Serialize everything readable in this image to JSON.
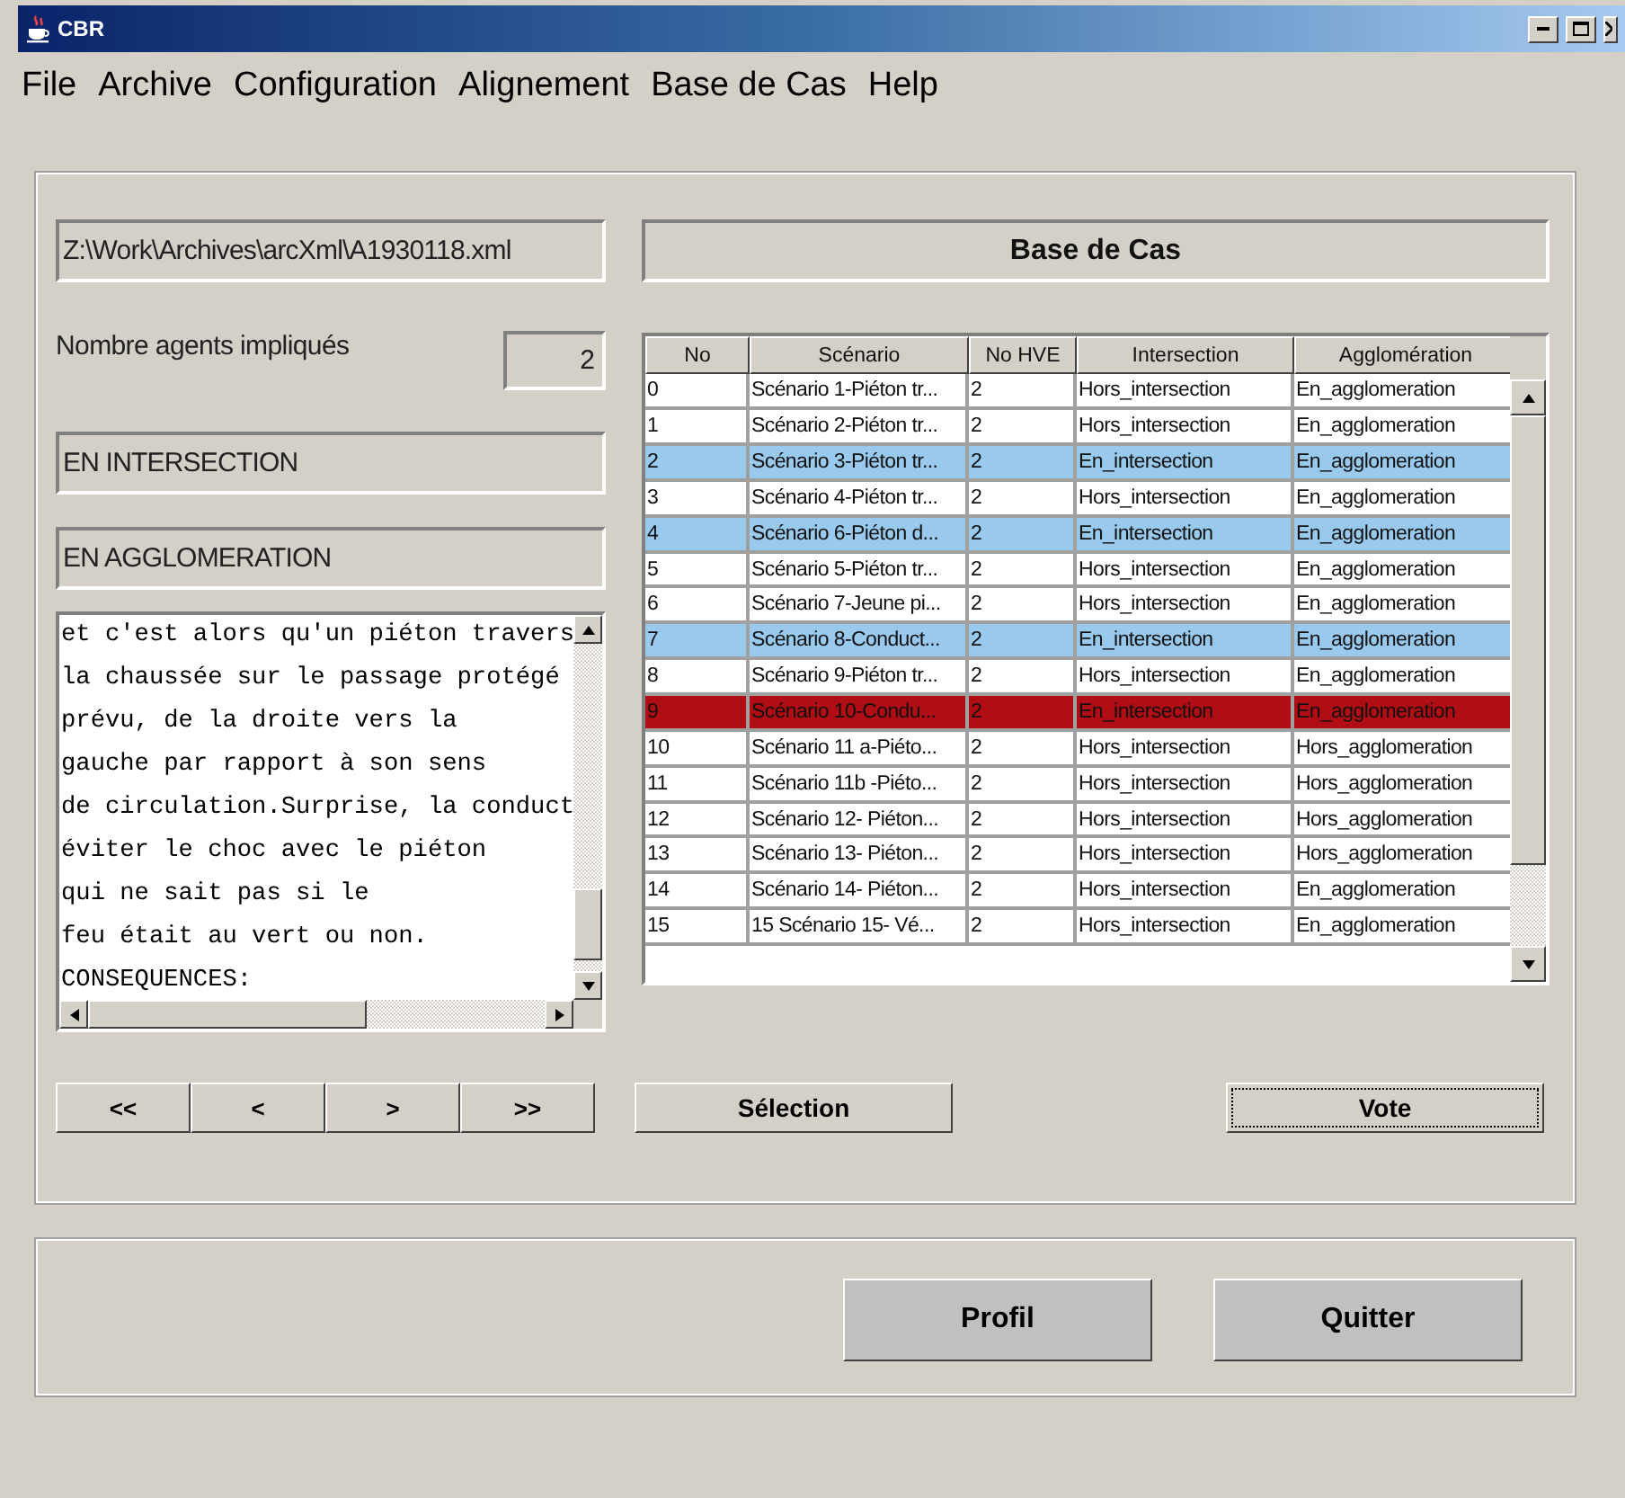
{
  "window": {
    "title": "CBR"
  },
  "menu": [
    "File",
    "Archive",
    "Configuration",
    "Alignement",
    "Base de Cas",
    "Help"
  ],
  "file_path": "Z:\\Work\\Archives\\arcXml\\A1930118.xml",
  "agents": {
    "label": "Nombre agents impliqués",
    "value": "2"
  },
  "intersection_field": "EN INTERSECTION",
  "agglomeration_field": "EN AGGLOMERATION",
  "description_lines": [
    "et c'est alors qu'un piéton travers",
    "la chaussée sur le passage protégé",
    "prévu, de la droite vers la",
    "gauche par rapport à son sens",
    "de circulation.Surprise, la conduct",
    "éviter le choc avec le piéton",
    "qui ne sait pas si le",
    "feu était au vert ou non.",
    "CONSEQUENCES:"
  ],
  "case_base": {
    "title": "Base de Cas",
    "columns": [
      "No",
      "Scénario",
      "No HVE",
      "Intersection",
      "Agglomération"
    ],
    "rows": [
      {
        "cells": [
          "0",
          "Scénario 1-Piéton tr...",
          "2",
          "Hors_intersection",
          "En_agglomeration"
        ],
        "matched": false,
        "selected": false
      },
      {
        "cells": [
          "1",
          "Scénario 2-Piéton tr...",
          "2",
          "Hors_intersection",
          "En_agglomeration"
        ],
        "matched": false,
        "selected": false
      },
      {
        "cells": [
          "2",
          "Scénario 3-Piéton tr...",
          "2",
          "En_intersection",
          "En_agglomeration"
        ],
        "matched": true,
        "selected": false
      },
      {
        "cells": [
          "3",
          "Scénario 4-Piéton tr...",
          "2",
          "Hors_intersection",
          "En_agglomeration"
        ],
        "matched": false,
        "selected": false
      },
      {
        "cells": [
          "4",
          "Scénario 6-Piéton d...",
          "2",
          "En_intersection",
          "En_agglomeration"
        ],
        "matched": true,
        "selected": false
      },
      {
        "cells": [
          "5",
          "Scénario 5-Piéton tr...",
          "2",
          "Hors_intersection",
          "En_agglomeration"
        ],
        "matched": false,
        "selected": false
      },
      {
        "cells": [
          "6",
          "Scénario 7-Jeune pi...",
          "2",
          "Hors_intersection",
          "En_agglomeration"
        ],
        "matched": false,
        "selected": false
      },
      {
        "cells": [
          "7",
          "Scénario 8-Conduct...",
          "2",
          "En_intersection",
          "En_agglomeration"
        ],
        "matched": true,
        "selected": false
      },
      {
        "cells": [
          "8",
          "Scénario 9-Piéton tr...",
          "2",
          "Hors_intersection",
          "En_agglomeration"
        ],
        "matched": false,
        "selected": false
      },
      {
        "cells": [
          "9",
          "Scénario 10-Condu...",
          "2",
          "En_intersection",
          "En_agglomeration"
        ],
        "matched": true,
        "selected": true
      },
      {
        "cells": [
          "10",
          "Scénario 11 a-Piéto...",
          "2",
          "Hors_intersection",
          "Hors_agglomeration"
        ],
        "matched": false,
        "selected": false
      },
      {
        "cells": [
          "11",
          "Scénario 11b -Piéto...",
          "2",
          "Hors_intersection",
          "Hors_agglomeration"
        ],
        "matched": false,
        "selected": false
      },
      {
        "cells": [
          "12",
          "Scénario 12- Piéton...",
          "2",
          "Hors_intersection",
          "Hors_agglomeration"
        ],
        "matched": false,
        "selected": false
      },
      {
        "cells": [
          "13",
          "Scénario 13- Piéton...",
          "2",
          "Hors_intersection",
          "Hors_agglomeration"
        ],
        "matched": false,
        "selected": false
      },
      {
        "cells": [
          "14",
          "Scénario 14- Piéton...",
          "2",
          "Hors_intersection",
          "En_agglomeration"
        ],
        "matched": false,
        "selected": false
      },
      {
        "cells": [
          "15",
          "15 Scénario 15- Vé...",
          "2",
          "Hors_intersection",
          "En_agglomeration"
        ],
        "matched": false,
        "selected": false
      }
    ]
  },
  "nav_buttons": [
    "<<",
    "<",
    ">",
    ">>"
  ],
  "buttons": [
    {
      "label": "Sélection",
      "focused": false
    },
    {
      "label": "Vote",
      "focused": true
    }
  ],
  "bottom_buttons": [
    "Profil",
    "Quitter"
  ]
}
